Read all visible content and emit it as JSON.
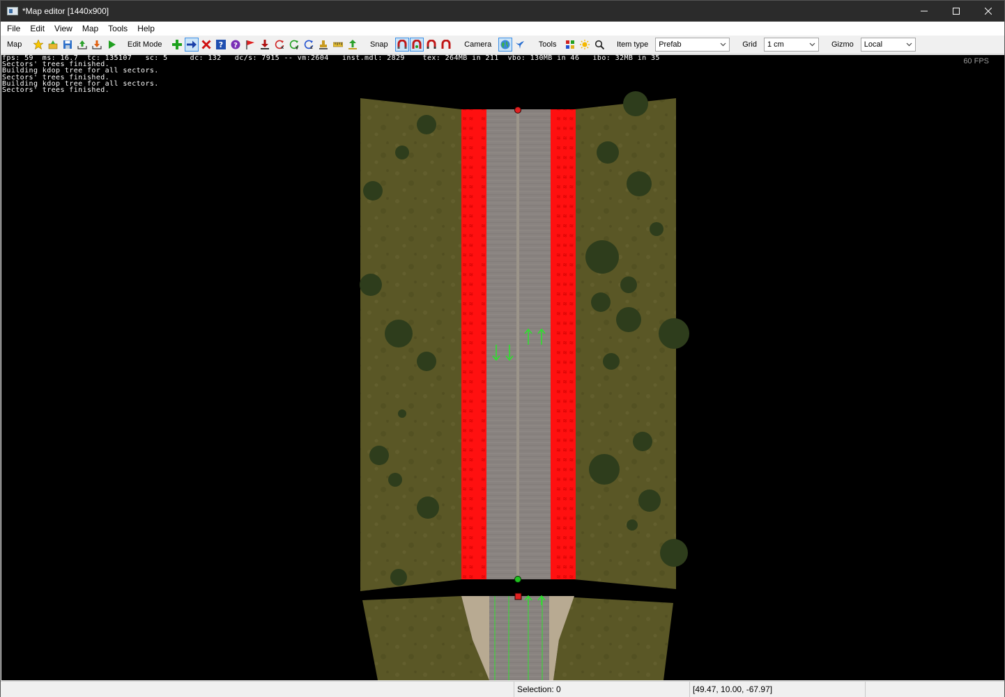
{
  "window": {
    "title": "*Map editor [1440x900]",
    "controls": [
      "minimize",
      "maximize",
      "close"
    ]
  },
  "menubar": {
    "items": [
      "File",
      "Edit",
      "View",
      "Map",
      "Tools",
      "Help"
    ]
  },
  "toolbar": {
    "map_label": "Map",
    "edit_mode_label": "Edit Mode",
    "snap_label": "Snap",
    "camera_label": "Camera",
    "tools_label": "Tools",
    "item_type_label": "Item type",
    "item_type_value": "Prefab",
    "grid_label": "Grid",
    "grid_value": "1 cm",
    "gizmo_label": "Gizmo",
    "gizmo_value": "Local"
  },
  "viewport": {
    "console_lines": [
      "fps: 59  ms: 16.7  tc: 135107   sc: 5     dc: 132   dc/s: 7915 -- vm:2604   inst.mdl: 2829    tex: 264MB in 211  vbo: 130MB in 46   ibo: 32MB in 35",
      "Sectors' trees finished.",
      "Building kdop tree for all sectors.",
      "Sectors' trees finished.",
      "Building kdop tree for all sectors.",
      "Sectors' trees finished."
    ],
    "fps_overlay": "60 FPS",
    "colors": {
      "background": "#000000",
      "terrain": "#5c5a2a",
      "road_shoulder_selected": "#ff0a0a",
      "asphalt": "#8a8580",
      "lane_arrow": "#2ee02e",
      "node_start": "#e02020",
      "node_end": "#20c020"
    }
  },
  "statusbar": {
    "selection": "Selection: 0",
    "coordinates": "[49.47, 10.00, -67.97]"
  }
}
